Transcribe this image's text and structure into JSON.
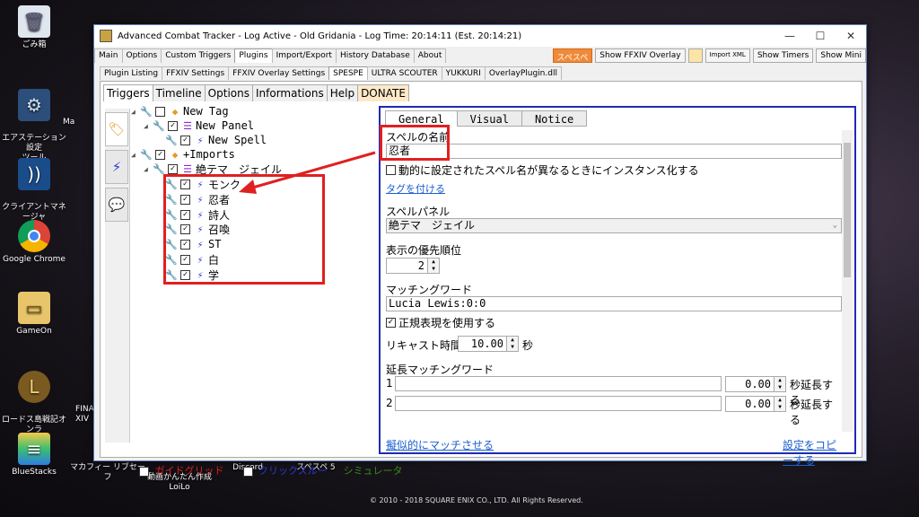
{
  "desktop": {
    "icons": [
      {
        "label": "ごみ箱"
      },
      {
        "label": "エアステーション設定\nツール"
      },
      {
        "label": "クライアントマネージャ\nV"
      },
      {
        "label": "Google Chrome"
      },
      {
        "label": "GameOn"
      },
      {
        "label": "ロードス島戦記オンラ\nイン"
      },
      {
        "label": "BlueStacks"
      }
    ],
    "taskbar_labels": [
      "マカフィー リブセーフ",
      "動画かんたん作成\nLoiLo",
      "Discord",
      "スペスペ 5"
    ],
    "partial_labels": [
      "Ma",
      "FINA\nXIV"
    ],
    "copyright": "© 2010 - 2018 SQUARE ENIX CO., LTD. All Rights Reserved."
  },
  "window": {
    "title": "Advanced Combat Tracker - Log Active - Old Gridania - Log Time: 20:14:11 (Est. 20:14:21)",
    "minimize": "—",
    "maximize": "☐",
    "close": "✕",
    "main_tabs": [
      "Main",
      "Options",
      "Custom Triggers",
      "Plugins",
      "Import/Export",
      "History Database",
      "About"
    ],
    "active_main_tab": "Plugins",
    "toolbar": {
      "spespe": "スペスペ",
      "ffxiv_overlay": "Show FFXIV Overlay",
      "import_xml": "Import XML",
      "show_timers": "Show Timers",
      "show_mini": "Show Mini"
    },
    "plugin_tabs": [
      "Plugin Listing",
      "FFXIV Settings",
      "FFXIV Overlay Settings",
      "SPESPE",
      "ULTRA SCOUTER",
      "YUKKURI",
      "OverlayPlugin.dll"
    ],
    "active_plugin_tab": "SPESPE"
  },
  "spespe": {
    "tabs": [
      "Triggers",
      "Timeline",
      "Options",
      "Informations",
      "Help",
      "DONATE"
    ],
    "tree": [
      {
        "label": "New Tag",
        "checked": false,
        "kind": "tag"
      },
      {
        "label": "New Panel",
        "checked": true,
        "kind": "panel"
      },
      {
        "label": "New Spell",
        "checked": true,
        "kind": "spell"
      },
      {
        "label": "+Imports",
        "checked": true,
        "kind": "tag"
      },
      {
        "label": "絶テマ　ジェイル",
        "checked": true,
        "kind": "panel"
      },
      {
        "label": "モンク",
        "checked": true,
        "kind": "spell"
      },
      {
        "label": "忍者",
        "checked": true,
        "kind": "spell"
      },
      {
        "label": "詩人",
        "checked": true,
        "kind": "spell"
      },
      {
        "label": "召喚",
        "checked": true,
        "kind": "spell"
      },
      {
        "label": "ST",
        "checked": true,
        "kind": "spell"
      },
      {
        "label": "白",
        "checked": true,
        "kind": "spell"
      },
      {
        "label": "学",
        "checked": true,
        "kind": "spell"
      }
    ],
    "bottom": {
      "guide_grid": "ガイドグリッド",
      "click_through": "クリックスルー",
      "simulator": "シミュレータ"
    },
    "detail": {
      "tabs": [
        "General",
        "Visual",
        "Notice"
      ],
      "spell_name_label": "スペルの名前",
      "spell_name_value": "忍者",
      "instance_checkbox": "動的に設定されたスペル名が異なるときにインスタンス化する",
      "tag_link": "タグを付ける",
      "panel_label": "スペルパネル",
      "panel_value": "絶テマ　ジェイル",
      "priority_label": "表示の優先順位",
      "priority_value": "2",
      "matching_label": "マッチングワード",
      "matching_value": "Lucia Lewis:0:0",
      "regex_checkbox": "正規表現を使用する",
      "recast_label": "リキャスト時間",
      "recast_value": "10.00",
      "recast_unit": "秒",
      "ext_label": "延長マッチングワード",
      "ext_rows": [
        {
          "index": "1",
          "value": "0.00",
          "suffix": "秒延長する"
        },
        {
          "index": "2",
          "value": "0.00",
          "suffix": "秒延長する"
        }
      ],
      "pseudo_match_link": "擬似的にマッチさせる",
      "copy_settings_link": "設定をコピーする"
    }
  },
  "colors": {
    "accent_red": "#e02020",
    "panel_border": "#1f2bb0",
    "link": "#1a5fd0"
  }
}
